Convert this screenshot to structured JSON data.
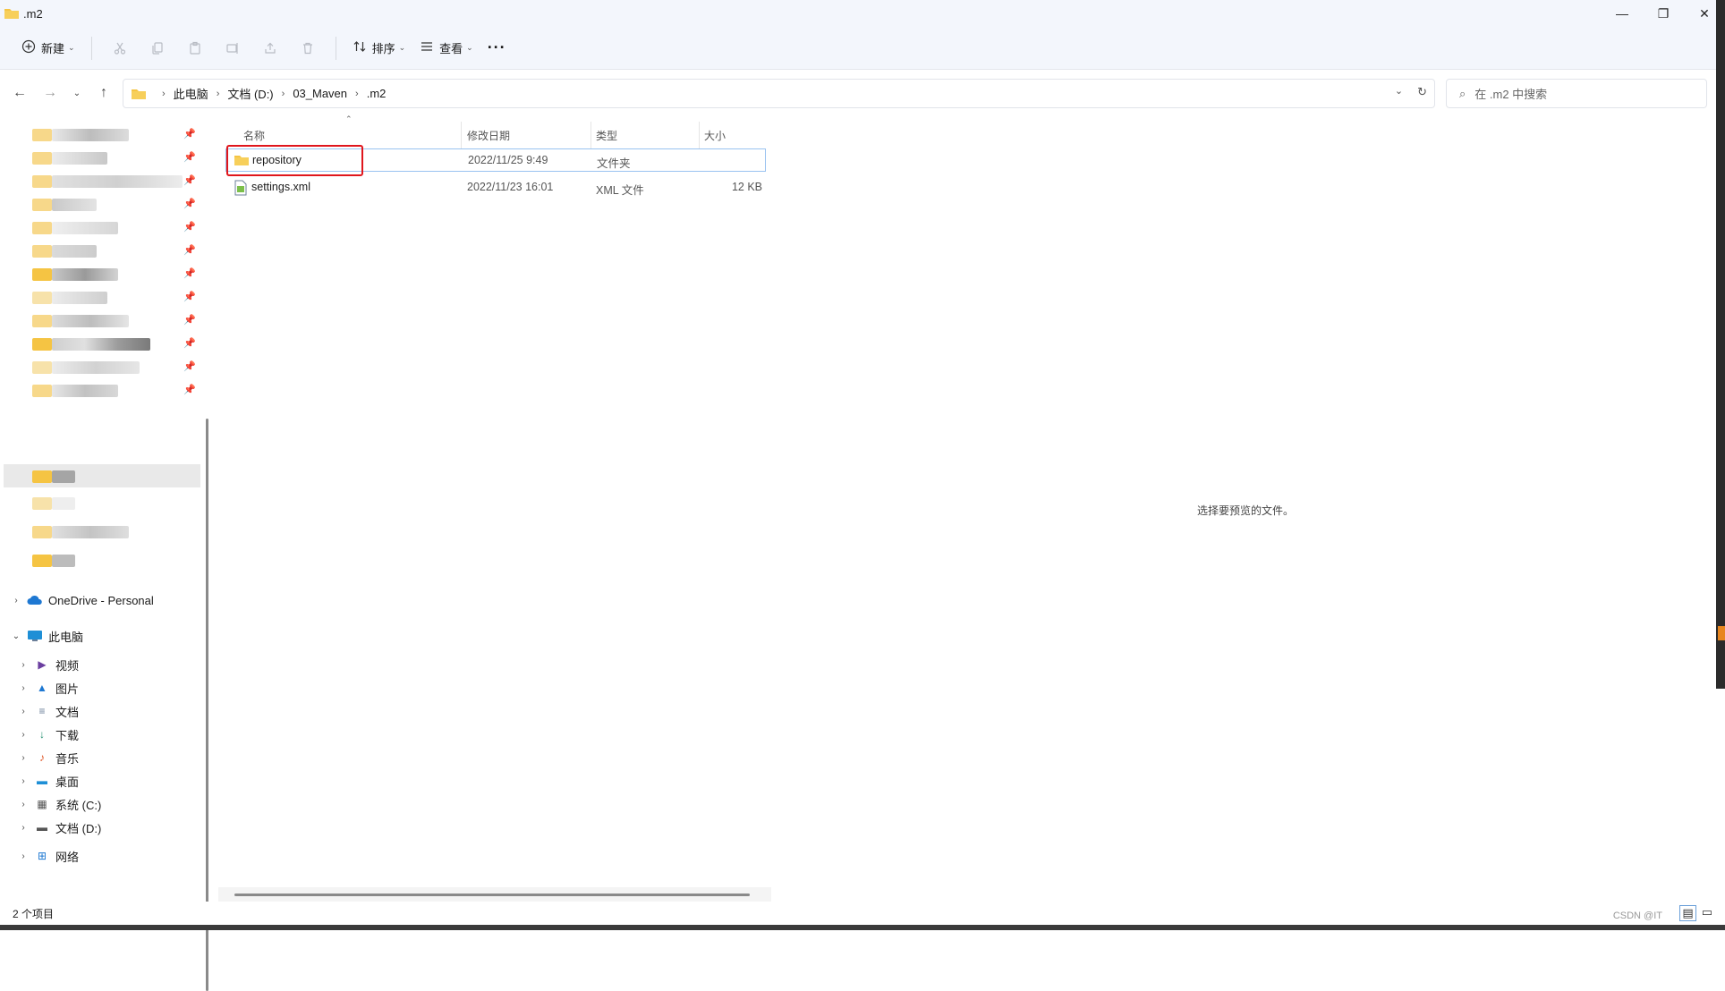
{
  "window": {
    "title": ".m2",
    "minimize": "—",
    "restore": "❐",
    "close": "✕"
  },
  "toolbar": {
    "new_label": "新建",
    "sort_label": "排序",
    "view_label": "查看",
    "more": "···"
  },
  "address": {
    "crumbs": [
      "此电脑",
      "文档 (D:)",
      "03_Maven",
      ".m2"
    ],
    "search_placeholder": "在 .m2 中搜索"
  },
  "nav": {
    "onedrive": "OneDrive - Personal",
    "this_pc": "此电脑",
    "items": [
      {
        "label": "视频",
        "icon": "video-icon",
        "color": "#6b3fa0"
      },
      {
        "label": "图片",
        "icon": "pictures-icon",
        "color": "#1e78d2"
      },
      {
        "label": "文档",
        "icon": "documents-icon",
        "color": "#6b7f99"
      },
      {
        "label": "下载",
        "icon": "download-icon",
        "color": "#1a8a6a"
      },
      {
        "label": "音乐",
        "icon": "music-icon",
        "color": "#e05a2b"
      },
      {
        "label": "桌面",
        "icon": "desktop-icon",
        "color": "#1e8fd6"
      },
      {
        "label": "系统 (C:)",
        "icon": "drive-c-icon",
        "color": "#555555"
      },
      {
        "label": "文档 (D:)",
        "icon": "drive-d-icon",
        "color": "#555555"
      },
      {
        "label": "网络",
        "icon": "network-icon",
        "color": "#1e78d2"
      }
    ]
  },
  "filelist": {
    "columns": [
      "名称",
      "修改日期",
      "类型",
      "大小"
    ],
    "rows": [
      {
        "name": "repository",
        "date": "2022/11/25 9:49",
        "type": "文件夹",
        "size": "",
        "icon": "folder-icon"
      },
      {
        "name": "settings.xml",
        "date": "2022/11/23 16:01",
        "type": "XML 文件",
        "size": "12 KB",
        "icon": "xml-file-icon"
      }
    ]
  },
  "preview": {
    "message": "选择要预览的文件。"
  },
  "status": {
    "count": "2 个项目",
    "watermark": "CSDN @IT"
  },
  "colors": {
    "accent_highlight": "#e0161c",
    "folder": "#f5c443",
    "selection_border": "#99c2f0"
  }
}
